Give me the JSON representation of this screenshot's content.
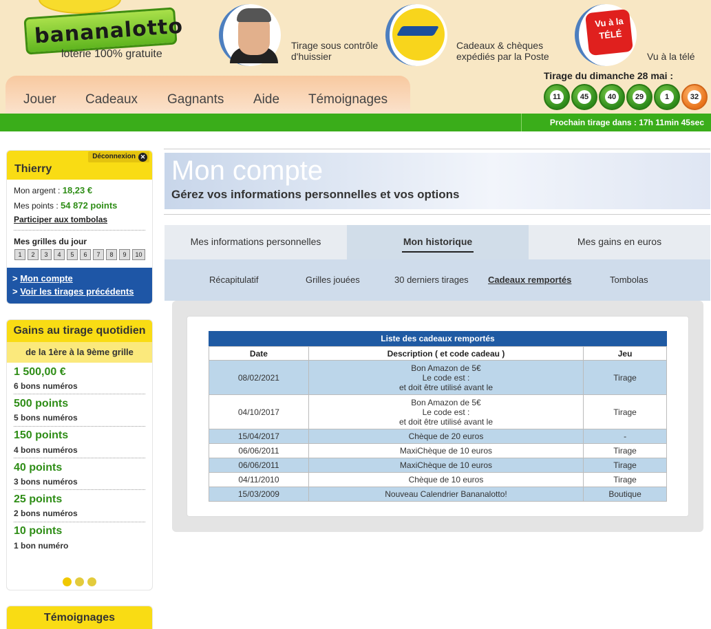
{
  "header": {
    "logo_name": "bananalotto",
    "tagline": "loterie 100% gratuite",
    "feature_huissier": [
      "Tirage sous contrôle",
      "d'huissier"
    ],
    "feature_poste": [
      "Cadeaux & chèques",
      "expédiés par la Poste"
    ],
    "feature_tele_badge": [
      "Vu à la",
      "TÉLÉ"
    ],
    "feature_tele": "Vu à la télé",
    "nav": [
      "Jouer",
      "Cadeaux",
      "Gagnants",
      "Aide",
      "Témoignages"
    ],
    "draw_title": "Tirage du dimanche 28 mai :",
    "balls": [
      "11",
      "45",
      "40",
      "29",
      "1"
    ],
    "bonus_ball": "32",
    "countdown": "Prochain tirage dans : 17h 11min 45sec"
  },
  "account": {
    "username": "Thierry",
    "logout_label": "Déconnexion",
    "logout_icon": "close-icon",
    "money_label": "Mon argent :",
    "money_value": "18,23 €",
    "points_label": "Mes points :",
    "points_value": "54 872 points",
    "tombola_link": "Participer aux tombolas",
    "grids_title": "Mes grilles du jour",
    "grids": [
      "1",
      "2",
      "3",
      "4",
      "5",
      "6",
      "7",
      "8",
      "9",
      "10"
    ],
    "links": [
      "Mon compte",
      "Voir les tirages précédents"
    ]
  },
  "gains": {
    "title": "Gains au tirage quotidien",
    "subtitle": "de la 1ère à la 9ème grille",
    "items": [
      {
        "amount": "1 500,00 €",
        "desc": "6 bons numéros"
      },
      {
        "amount": "500 points",
        "desc": "5 bons numéros"
      },
      {
        "amount": "150 points",
        "desc": "4 bons numéros"
      },
      {
        "amount": "40 points",
        "desc": "3 bons numéros"
      },
      {
        "amount": "25 points",
        "desc": "2 bons numéros"
      },
      {
        "amount": "10 points",
        "desc": "1 bon numéro"
      }
    ]
  },
  "testimonials_title": "Témoignages",
  "main": {
    "title": "Mon compte",
    "subtitle": "Gérez vos informations personnelles et vos options",
    "tabs": [
      "Mes informations personnelles",
      "Mon historique",
      "Mes gains en euros"
    ],
    "active_tab": 1,
    "subtabs": [
      "Récapitulatif",
      "Grilles jouées",
      "30 derniers tirages",
      "Cadeaux remportés",
      "Tombolas"
    ],
    "active_subtab": 3,
    "table": {
      "caption": "Liste des cadeaux remportés",
      "headers": [
        "Date",
        "Description ( et code cadeau )",
        "Jeu"
      ],
      "rows": [
        {
          "date": "08/02/2021",
          "desc": [
            "Bon Amazon de 5€",
            "Le code est :",
            "et doit être utilisé avant le"
          ],
          "jeu": "Tirage"
        },
        {
          "date": "04/10/2017",
          "desc": [
            "Bon Amazon de 5€",
            "Le code est :",
            "et doit être utilisé avant le"
          ],
          "jeu": "Tirage"
        },
        {
          "date": "15/04/2017",
          "desc": [
            "Chèque de 20 euros"
          ],
          "jeu": "-"
        },
        {
          "date": "06/06/2011",
          "desc": [
            "MaxiChèque de 10 euros"
          ],
          "jeu": "Tirage"
        },
        {
          "date": "06/06/2011",
          "desc": [
            "MaxiChèque de 10 euros"
          ],
          "jeu": "Tirage"
        },
        {
          "date": "04/11/2010",
          "desc": [
            "Chèque de 10 euros"
          ],
          "jeu": "Tirage"
        },
        {
          "date": "15/03/2009",
          "desc": [
            "Nouveau Calendrier Bananalotto!"
          ],
          "jeu": "Boutique"
        }
      ]
    }
  },
  "colors": {
    "header_bg": "#f8e7c4",
    "accent_green": "#3aad1a",
    "accent_yellow": "#f9dc14",
    "table_header_blue": "#1f5aa3",
    "row_blue": "#bcd6ea"
  }
}
